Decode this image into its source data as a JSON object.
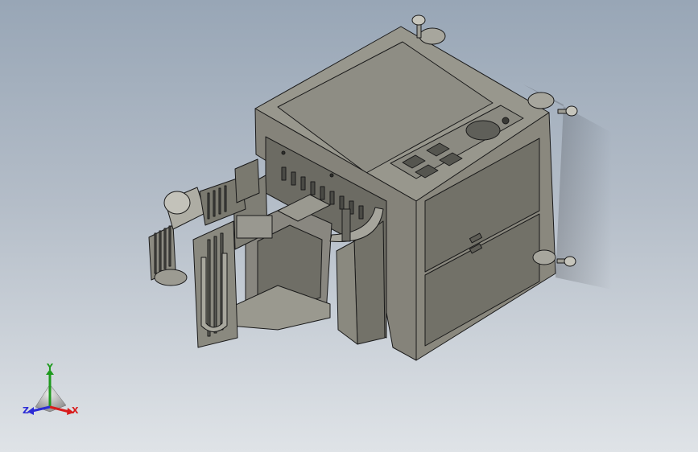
{
  "scene": {
    "type": "cad-3d-viewport",
    "background_top": "#98a6b6",
    "background_bottom": "#dfe3e7",
    "model_color": "#8e8c80",
    "edge_color": "#1a1a1a"
  },
  "triad": {
    "y_label": "Y",
    "x_label": "X",
    "z_label": "Z",
    "y_color": "#1e9a1e",
    "x_color": "#d81c1c",
    "z_color": "#2c2cd6"
  }
}
